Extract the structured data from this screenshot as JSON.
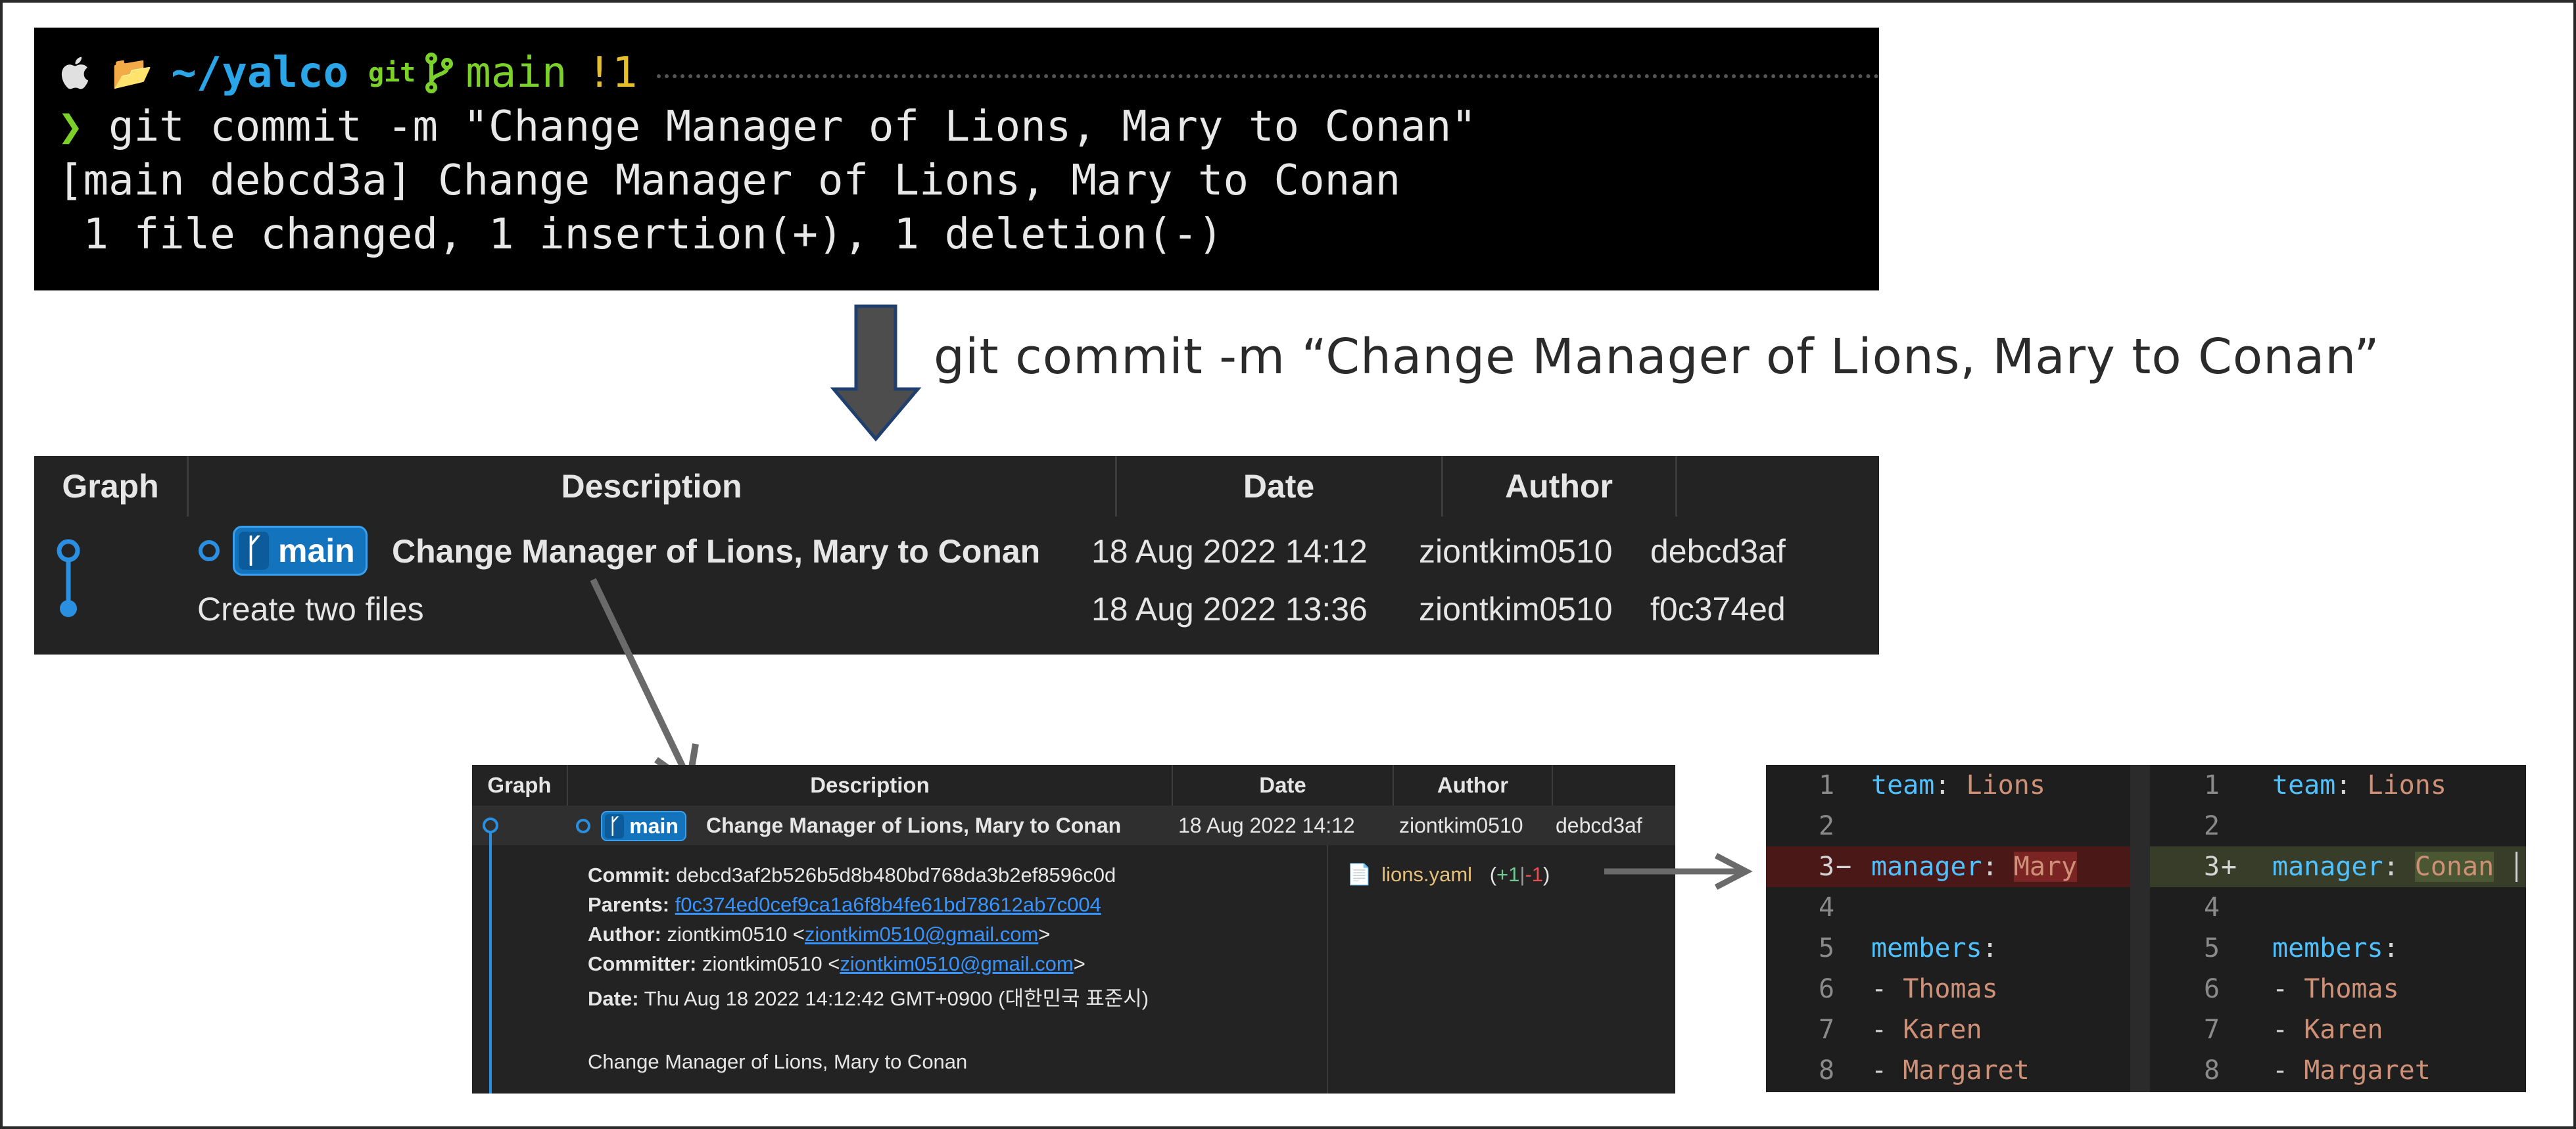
{
  "terminal": {
    "path": "~/yalco",
    "git_label": "git",
    "branch": "main",
    "status": "!1",
    "prompt_symbol": "❯",
    "command": "git commit -m \"Change Manager of Lions, Mary to Conan\"",
    "output_line1": "[main debcd3a] Change Manager of Lions, Mary to Conan",
    "output_line2": " 1 file changed, 1 insertion(+), 1 deletion(-)"
  },
  "caption": "git commit -m “Change Manager of Lions, Mary to Conan”",
  "graph_large": {
    "headers": {
      "graph": "Graph",
      "description": "Description",
      "date": "Date",
      "author": "Author"
    },
    "rows": [
      {
        "branch": "main",
        "description": "Change Manager of Lions, Mary to Conan",
        "date": "18 Aug 2022 14:12",
        "author": "ziontkim0510",
        "hash": "debcd3af"
      },
      {
        "branch": "",
        "description": "Create two files",
        "date": "18 Aug 2022 13:36",
        "author": "ziontkim0510",
        "hash": "f0c374ed"
      }
    ]
  },
  "graph_small": {
    "headers": {
      "graph": "Graph",
      "description": "Description",
      "date": "Date",
      "author": "Author"
    },
    "row": {
      "branch": "main",
      "description": "Change Manager of Lions, Mary to Conan",
      "date": "18 Aug 2022 14:12",
      "author": "ziontkim0510",
      "hash": "debcd3af"
    },
    "details": {
      "commit_label": "Commit:",
      "commit": "debcd3af2b526b5d8b480bd768da3b2ef8596c0d",
      "parents_label": "Parents:",
      "parents": "f0c374ed0cef9ca1a6f8b4fe61bd78612ab7c004",
      "author_label": "Author:",
      "author_name": "ziontkim0510 <",
      "author_email": "ziontkim0510@gmail.com",
      "committer_label": "Committer:",
      "committer_name": "ziontkim0510 <",
      "committer_email": "ziontkim0510@gmail.com",
      "close": ">",
      "date_label": "Date:",
      "date": "Thu Aug 18 2022 14:12:42 GMT+0900 (대한민국 표준시)",
      "message": "Change Manager of Lions, Mary to Conan"
    },
    "file": {
      "name": "lions.yaml",
      "open": "(",
      "added": "+1",
      "sep": "|",
      "removed": "-1",
      "close": ")"
    }
  },
  "diff": {
    "left": [
      {
        "n": "1",
        "key": "team",
        "val": "Lions"
      },
      {
        "n": "2",
        "key": "",
        "val": ""
      },
      {
        "n": "3",
        "mark": "−",
        "key": "manager",
        "val": "Mary"
      },
      {
        "n": "4",
        "key": "",
        "val": ""
      },
      {
        "n": "5",
        "key": "members",
        "val": ""
      },
      {
        "n": "6",
        "dash": "-",
        "val": "Thomas"
      },
      {
        "n": "7",
        "dash": "-",
        "val": "Karen"
      },
      {
        "n": "8",
        "dash": "-",
        "val": "Margaret"
      }
    ],
    "right": [
      {
        "n": "1",
        "key": "team",
        "val": "Lions"
      },
      {
        "n": "2",
        "key": "",
        "val": ""
      },
      {
        "n": "3",
        "mark": "+",
        "key": "manager",
        "val": "Conan"
      },
      {
        "n": "4",
        "key": "",
        "val": ""
      },
      {
        "n": "5",
        "key": "members",
        "val": ""
      },
      {
        "n": "6",
        "dash": "-",
        "val": "Thomas"
      },
      {
        "n": "7",
        "dash": "-",
        "val": "Karen"
      },
      {
        "n": "8",
        "dash": "-",
        "val": "Margaret"
      }
    ]
  },
  "colors": {
    "accent_blue": "#1473bd",
    "terminal_green": "#7bd12a",
    "terminal_yellow": "#e5c02a",
    "link_blue": "#3794ff"
  }
}
